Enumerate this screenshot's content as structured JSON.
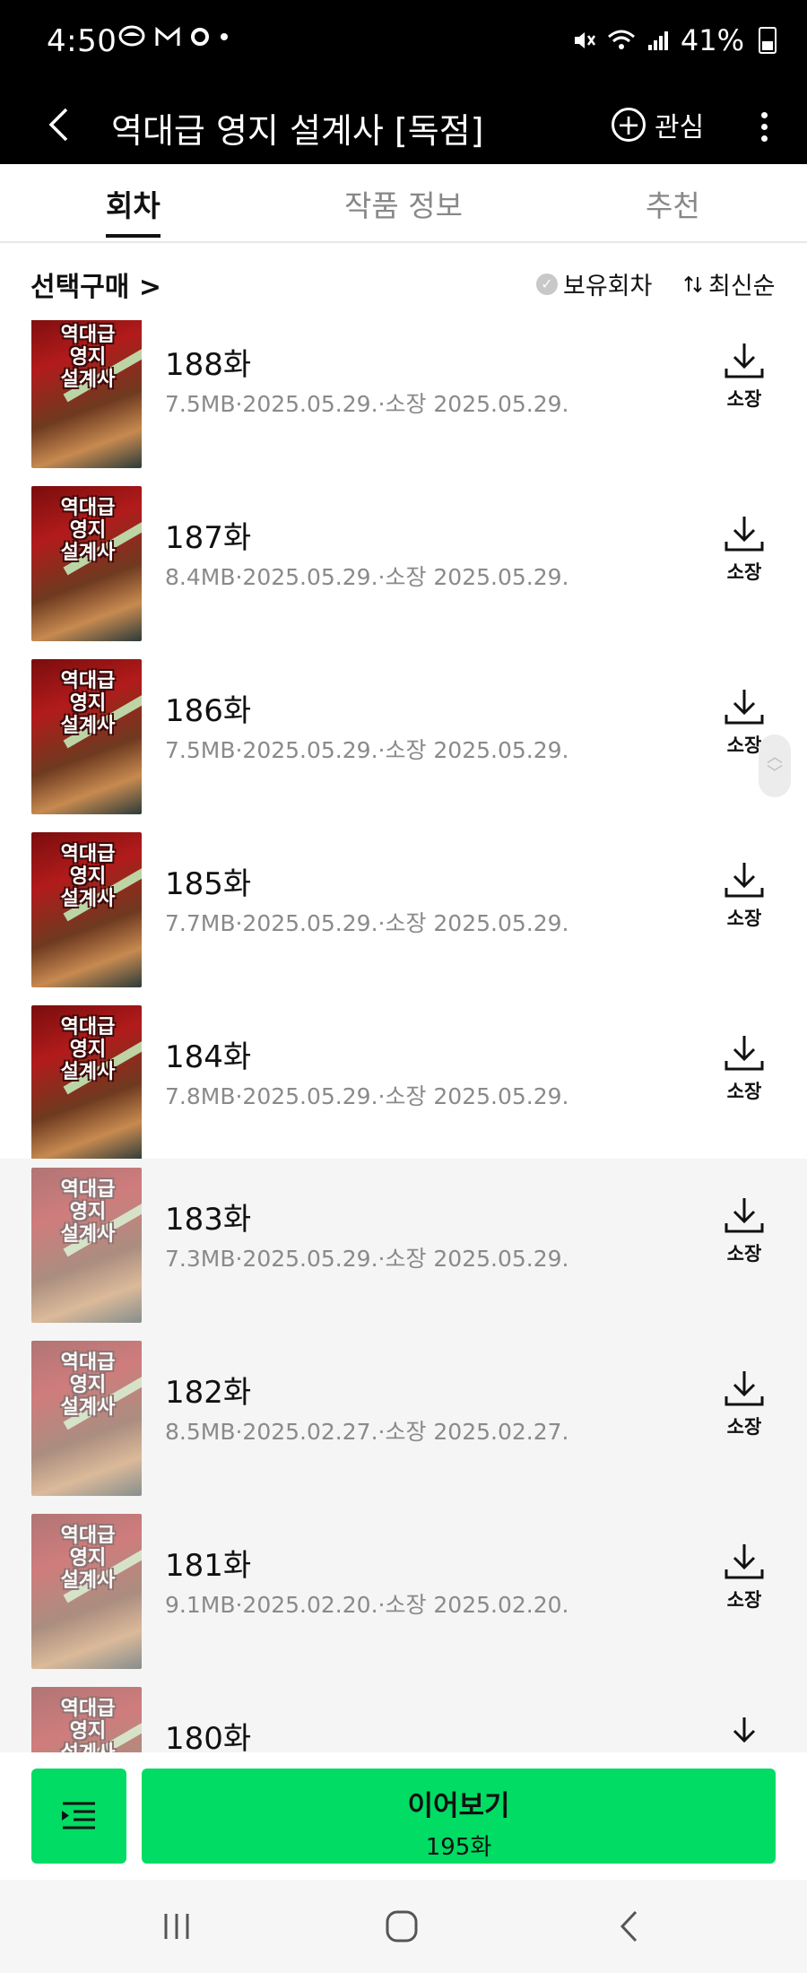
{
  "status_bar": {
    "time": "4:50",
    "battery": "41%",
    "left_icons": [
      "chat-bubble-icon",
      "mail-icon",
      "record-icon",
      "dot-icon"
    ],
    "right_icons": [
      "mute-icon",
      "wifi-icon",
      "signal-icon",
      "battery-icon"
    ]
  },
  "app_bar": {
    "title": "역대급 영지 설계사 [독점]",
    "favorite_label": "관심"
  },
  "tabs": [
    {
      "label": "회차",
      "active": true
    },
    {
      "label": "작품 정보",
      "active": false
    },
    {
      "label": "추천",
      "active": false
    }
  ],
  "filter": {
    "select_buy": "선택구매 >",
    "owned": "보유회차",
    "sort": "최신순"
  },
  "thumbnail_text": [
    "역대급",
    "영지",
    "설계사"
  ],
  "episodes": [
    {
      "title": "188화",
      "meta": "7.5MB·2025.05.29.·소장 2025.05.29.",
      "download_label": "소장",
      "read": false
    },
    {
      "title": "187화",
      "meta": "8.4MB·2025.05.29.·소장 2025.05.29.",
      "download_label": "소장",
      "read": false
    },
    {
      "title": "186화",
      "meta": "7.5MB·2025.05.29.·소장 2025.05.29.",
      "download_label": "소장",
      "read": false
    },
    {
      "title": "185화",
      "meta": "7.7MB·2025.05.29.·소장 2025.05.29.",
      "download_label": "소장",
      "read": false
    },
    {
      "title": "184화",
      "meta": "7.8MB·2025.05.29.·소장 2025.05.29.",
      "download_label": "소장",
      "read": false
    },
    {
      "title": "183화",
      "meta": "7.3MB·2025.05.29.·소장 2025.05.29.",
      "download_label": "소장",
      "read": true
    },
    {
      "title": "182화",
      "meta": "8.5MB·2025.02.27.·소장 2025.02.27.",
      "download_label": "소장",
      "read": true
    },
    {
      "title": "181화",
      "meta": "9.1MB·2025.02.20.·소장 2025.02.20.",
      "download_label": "소장",
      "read": true
    },
    {
      "title": "180화",
      "meta": "",
      "download_label": "",
      "read": true
    }
  ],
  "bottom": {
    "continue_label": "이어보기",
    "continue_episode": "195화"
  },
  "colors": {
    "accent_green": "#00dc64",
    "header_bg": "#000000",
    "read_row_bg": "#f5f5f5"
  }
}
